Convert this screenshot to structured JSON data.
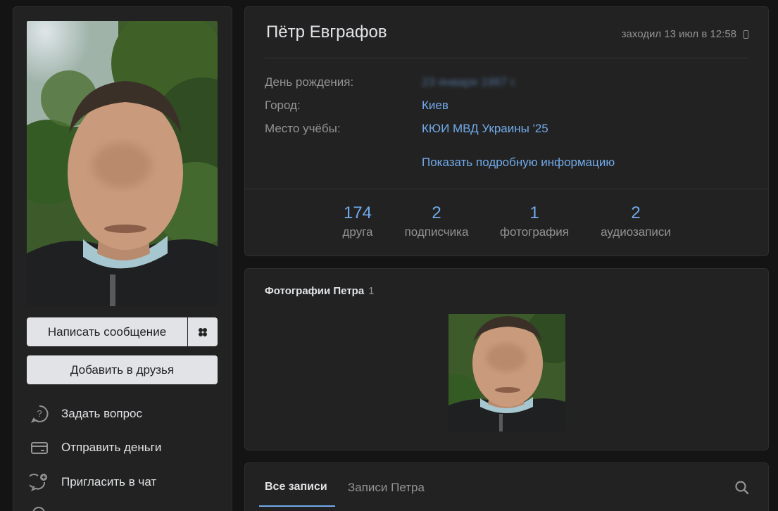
{
  "profile": {
    "name": "Пётр Евграфов",
    "last_seen": "заходил 13 июл в 12:58",
    "info": [
      {
        "key": "День рождения:",
        "value": "23 января 1987 г."
      },
      {
        "key": "Город:",
        "value": "Киев"
      },
      {
        "key": "Место учёбы:",
        "value": "КЮИ МВД Украины '25"
      }
    ],
    "more_link": "Показать подробную информацию",
    "counters": [
      {
        "number": "174",
        "label": "друга"
      },
      {
        "number": "2",
        "label": "подписчика"
      },
      {
        "number": "1",
        "label": "фотография"
      },
      {
        "number": "2",
        "label": "аудиозаписи"
      }
    ]
  },
  "left": {
    "message_button": "Написать сообщение",
    "add_friend_button": "Добавить в друзья",
    "actions": [
      {
        "label": "Задать вопрос",
        "icon": "question-icon"
      },
      {
        "label": "Отправить деньги",
        "icon": "money-card-icon"
      },
      {
        "label": "Пригласить в чат",
        "icon": "chat-invite-icon"
      }
    ]
  },
  "photos": {
    "title": "Фотографии Петра",
    "count": "1"
  },
  "wall": {
    "tabs": [
      "Все записи",
      "Записи Петра"
    ]
  },
  "colors": {
    "background": "#141414",
    "card": "#222222",
    "accent": "#71aaeb",
    "muted": "#939393",
    "button": "#e1e3e6"
  }
}
